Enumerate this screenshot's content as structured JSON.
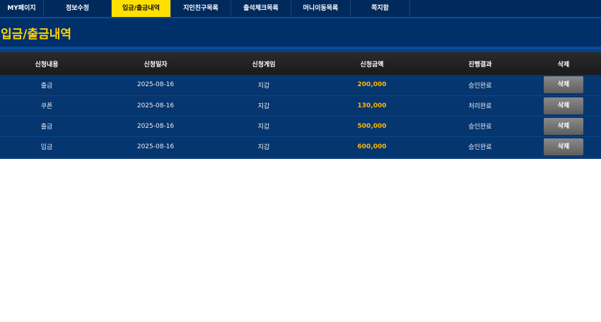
{
  "nav": {
    "tabs": [
      {
        "label": "MY페이지",
        "active": false
      },
      {
        "label": "정보수정",
        "active": false
      },
      {
        "label": "입금/출금내역",
        "active": true
      },
      {
        "label": "지인친구목록",
        "active": false
      },
      {
        "label": "출석체크목록",
        "active": false
      },
      {
        "label": "머니이동목록",
        "active": false
      },
      {
        "label": "쪽지함",
        "active": false
      }
    ]
  },
  "page": {
    "title": "입금/출금내역"
  },
  "table": {
    "headers": [
      "신청내용",
      "신청일자",
      "신청게임",
      "신청금액",
      "진행결과",
      "삭제"
    ],
    "rows": [
      {
        "type": "출금",
        "date": "2025-08-16",
        "game": "지갑",
        "amount": "200,000",
        "result": "승인완료",
        "action": "삭제"
      },
      {
        "type": "쿠폰",
        "date": "2025-08-16",
        "game": "지갑",
        "amount": "130,000",
        "result": "처리완료",
        "action": "삭제"
      },
      {
        "type": "출금",
        "date": "2025-08-16",
        "game": "지갑",
        "amount": "500,000",
        "result": "승인완료",
        "action": "삭제"
      },
      {
        "type": "입금",
        "date": "2025-08-16",
        "game": "지갑",
        "amount": "600,000",
        "result": "승인완료",
        "action": "삭제"
      }
    ]
  },
  "colors": {
    "background": "#002a5c",
    "accent": "#ffe000",
    "title": "#ffd400",
    "amount": "#ffb600",
    "header_bg": "#222222",
    "button": "#707070"
  }
}
